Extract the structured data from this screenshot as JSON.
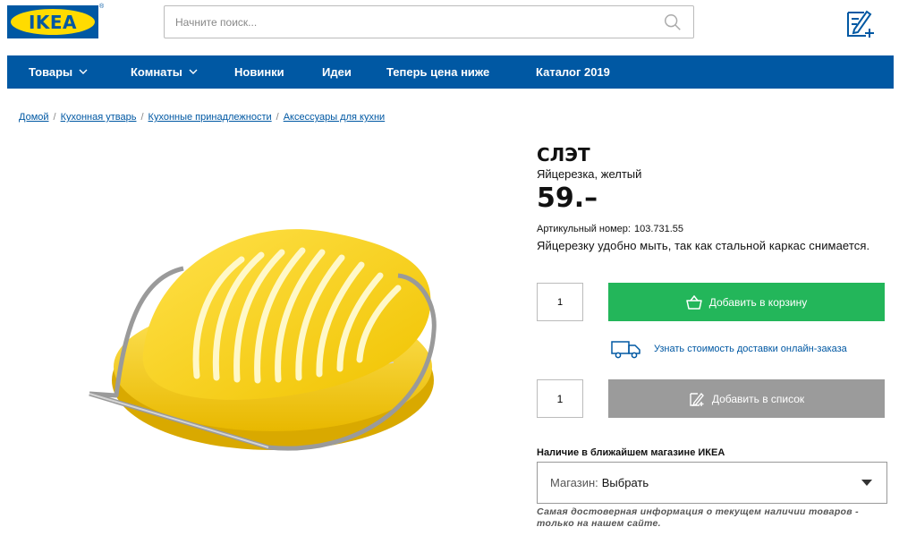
{
  "header": {
    "logo_text": "IKEA",
    "logo_reg": "®",
    "search_placeholder": "Начните поиск..."
  },
  "nav": {
    "items": [
      {
        "label": "Товары",
        "has_dropdown": true
      },
      {
        "label": "Комнаты",
        "has_dropdown": true
      },
      {
        "label": "Новинки",
        "has_dropdown": false
      },
      {
        "label": "Идеи",
        "has_dropdown": false
      },
      {
        "label": "Теперь цена ниже",
        "has_dropdown": false
      },
      {
        "label": "Каталог 2019",
        "has_dropdown": false
      }
    ]
  },
  "breadcrumb": [
    "Домой",
    "Кухонная утварь",
    "Кухонные принадлежности",
    "Аксессуары для кухни"
  ],
  "product": {
    "name": "СЛЭТ",
    "description": "Яйцерезка, желтый",
    "price": "59.–",
    "article_label": "Артикульный номер:",
    "article_number": "103.731.55",
    "text": "Яйцерезку удобно мыть, так как стальной каркас снимается."
  },
  "purchase": {
    "qty_cart": "1",
    "add_to_cart": "Добавить в корзину",
    "delivery_link": "Узнать стоимость доставки онлайн-заказа",
    "qty_list": "1",
    "add_to_list": "Добавить в список"
  },
  "store": {
    "label": "Наличие в ближайшем магазине ИКЕА",
    "select_prefix": "Магазин:",
    "select_value": "Выбрать",
    "note": "Самая достоверная информация о текущем наличии товаров - только на нашем сайте."
  },
  "colors": {
    "brand_blue": "#0058a3",
    "brand_yellow": "#ffdb00",
    "cart_green": "#23b65a",
    "list_gray": "#9b9b9b"
  }
}
